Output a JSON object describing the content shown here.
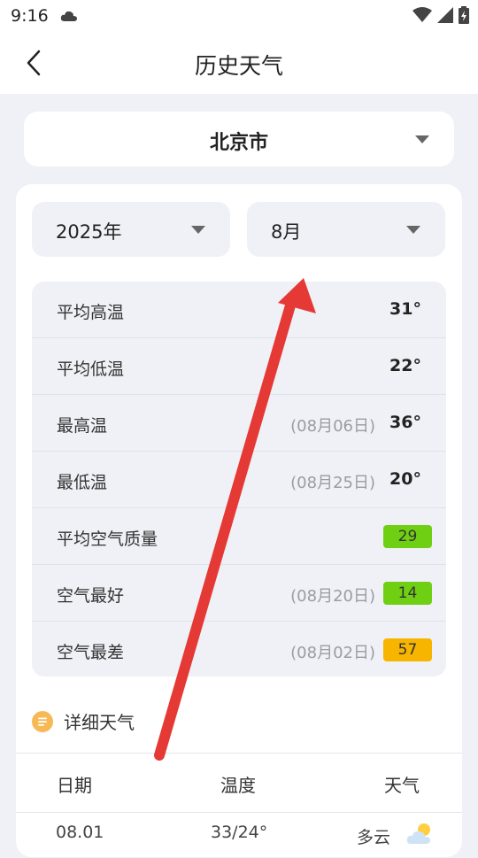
{
  "status": {
    "time": "9:16"
  },
  "header": {
    "title": "历史天气"
  },
  "city": {
    "name": "北京市"
  },
  "filters": {
    "year": "2025年",
    "month": "8月"
  },
  "stats": [
    {
      "label": "平均高温",
      "date": "",
      "value": "31°"
    },
    {
      "label": "平均低温",
      "date": "",
      "value": "22°"
    },
    {
      "label": "最高温",
      "date": "(08月06日)",
      "value": "36°"
    },
    {
      "label": "最低温",
      "date": "(08月25日)",
      "value": "20°"
    },
    {
      "label": "平均空气质量",
      "date": "",
      "aqi": "29",
      "aqi_color": "#6fcf12"
    },
    {
      "label": "空气最好",
      "date": "(08月20日)",
      "aqi": "14",
      "aqi_color": "#6fcf12"
    },
    {
      "label": "空气最差",
      "date": "(08月02日)",
      "aqi": "57",
      "aqi_color": "#f7b500"
    }
  ],
  "section": {
    "title": "详细天气"
  },
  "table": {
    "headers": [
      "日期",
      "温度",
      "天气"
    ],
    "rows": [
      {
        "date": "08.01",
        "temp": "33/24°",
        "weather": "多云",
        "icon": "partly-cloudy-icon"
      }
    ]
  },
  "colors": {
    "accent": "#f7b955",
    "arrow": "#e53935"
  }
}
